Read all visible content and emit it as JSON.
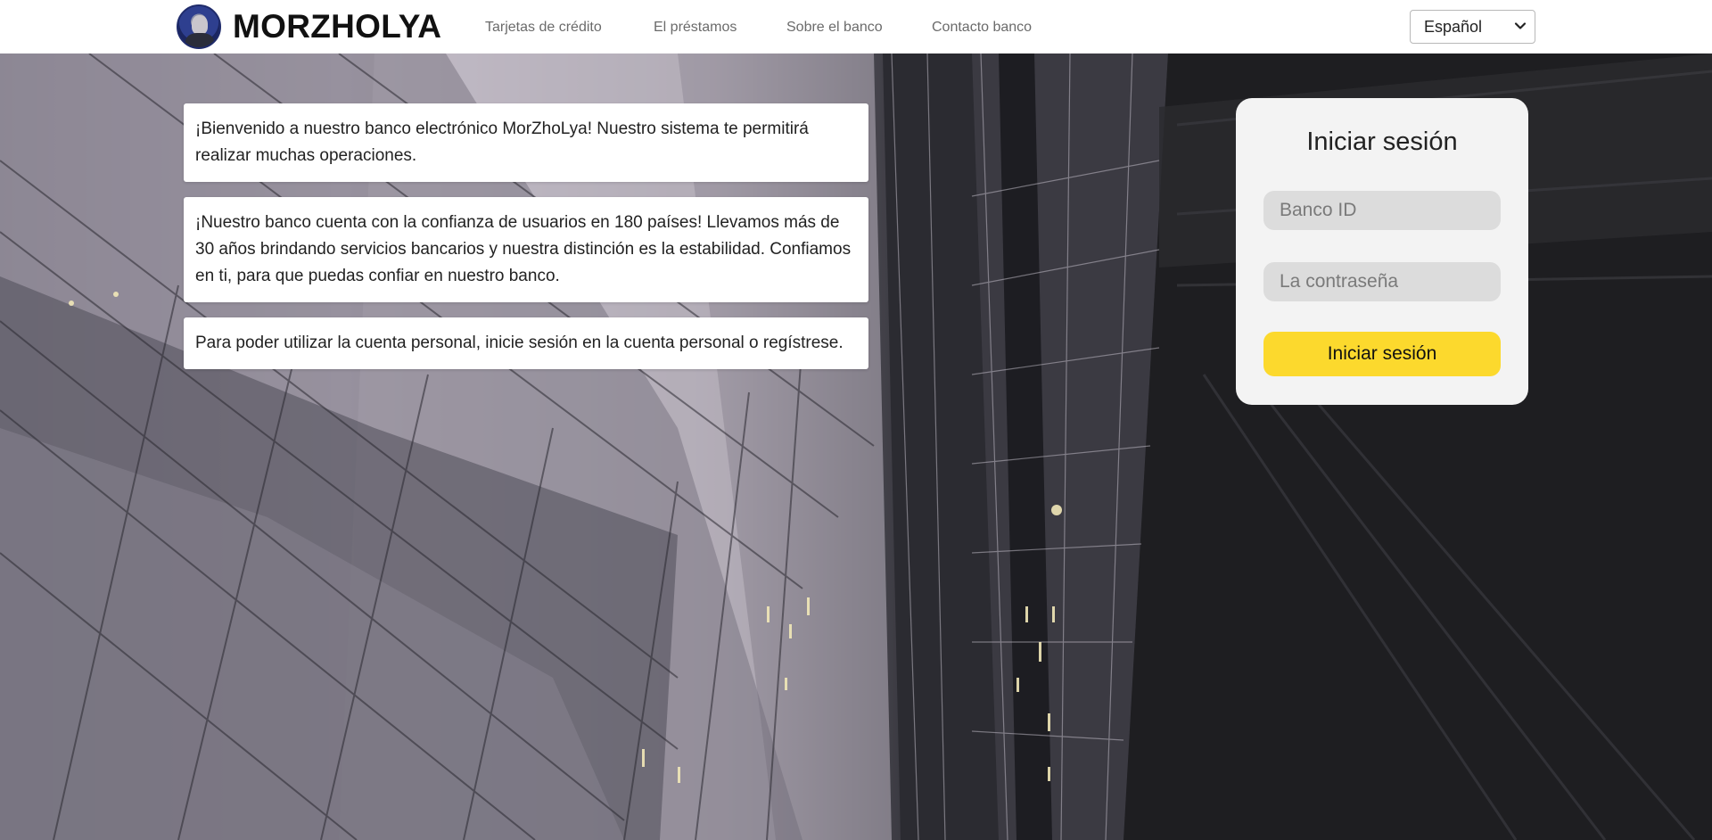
{
  "header": {
    "brand": "MORZHOLYA",
    "logo_icon": "avatar-portrait",
    "nav": [
      {
        "label": "Tarjetas de crédito"
      },
      {
        "label": "El préstamos"
      },
      {
        "label": "Sobre el banco"
      },
      {
        "label": "Contacto banco"
      }
    ],
    "language": {
      "selected": "Español",
      "icon": "chevron-down-icon"
    }
  },
  "cards": [
    {
      "text": "¡Bienvenido a nuestro banco electrónico MorZhoLya! Nuestro sistema te permitirá realizar muchas operaciones."
    },
    {
      "text": "¡Nuestro banco cuenta con la confianza de usuarios en 180 países! Llevamos más de 30 años brindando servicios bancarios y nuestra distinción es la estabilidad. Confiamos en ti, para que puedas confiar en nuestro banco."
    },
    {
      "text": "Para poder utilizar la cuenta personal, inicie sesión en la cuenta personal o regístrese."
    }
  ],
  "login": {
    "title": "Iniciar sesión",
    "bank_id_placeholder": "Banco ID",
    "password_placeholder": "La contraseña",
    "submit_label": "Iniciar sesión"
  },
  "colors": {
    "accent": "#fcd92d",
    "panel": "#f3f3f3",
    "input": "#dcdcdc"
  }
}
